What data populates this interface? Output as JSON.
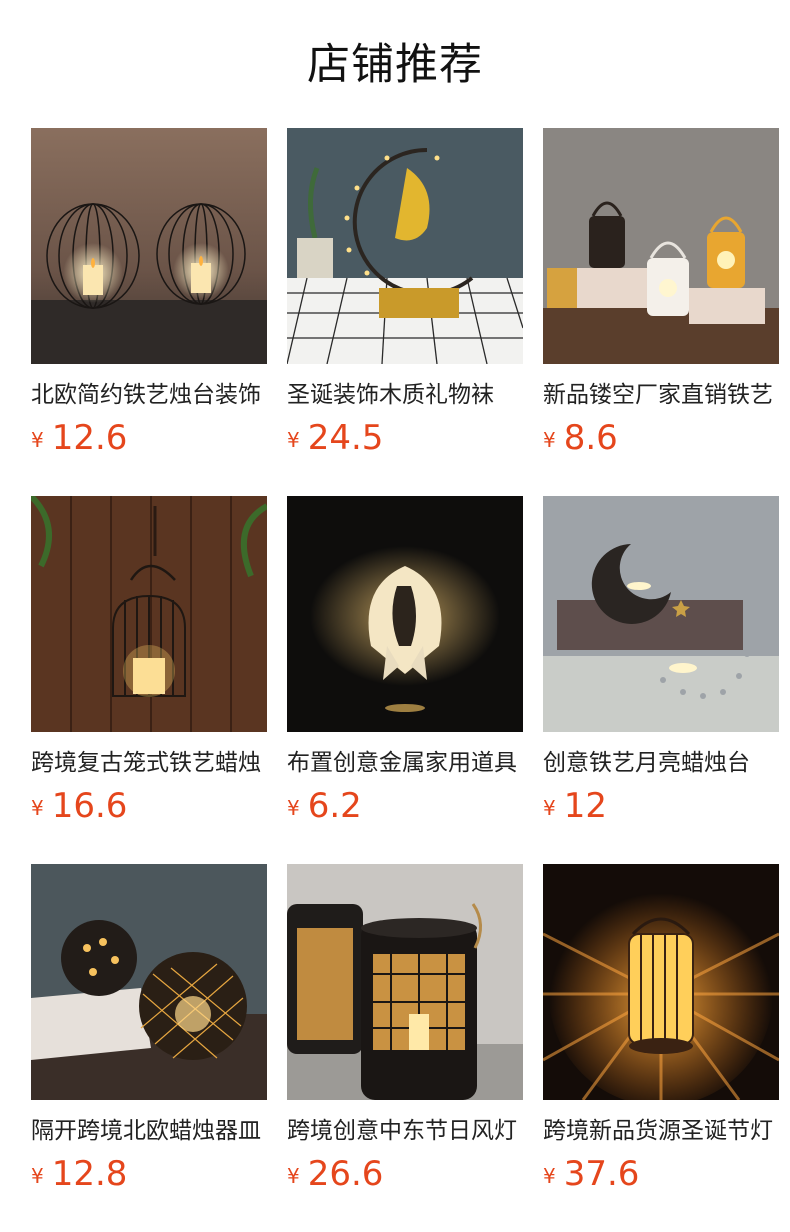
{
  "page": {
    "title": "店铺推荐"
  },
  "currency": "¥",
  "products": [
    {
      "name": "北欧简约铁艺烛台装饰",
      "price": "12.6",
      "image": "wire-cage-candle-holders"
    },
    {
      "name": "圣诞装饰木质礼物袜",
      "price": "24.5",
      "image": "crescent-moon-light-decoration"
    },
    {
      "name": "新品镂空厂家直销铁艺",
      "price": "8.6",
      "image": "hollow-lanterns-trio"
    },
    {
      "name": "跨境复古笼式铁艺蜡烛",
      "price": "16.6",
      "image": "hanging-birdcage-lantern"
    },
    {
      "name": "布置创意金属家用道具",
      "price": "6.2",
      "image": "angel-silhouette-candle"
    },
    {
      "name": "创意铁艺月亮蜡烛台",
      "price": "12",
      "image": "moon-candle-holders"
    },
    {
      "name": "隔开跨境北欧蜡烛器皿",
      "price": "12.8",
      "image": "lattice-orb-candle-holders"
    },
    {
      "name": "跨境创意中东节日风灯",
      "price": "26.6",
      "image": "middle-east-lanterns"
    },
    {
      "name": "跨境新品货源圣诞节灯",
      "price": "37.6",
      "image": "glowing-cage-lantern"
    }
  ]
}
